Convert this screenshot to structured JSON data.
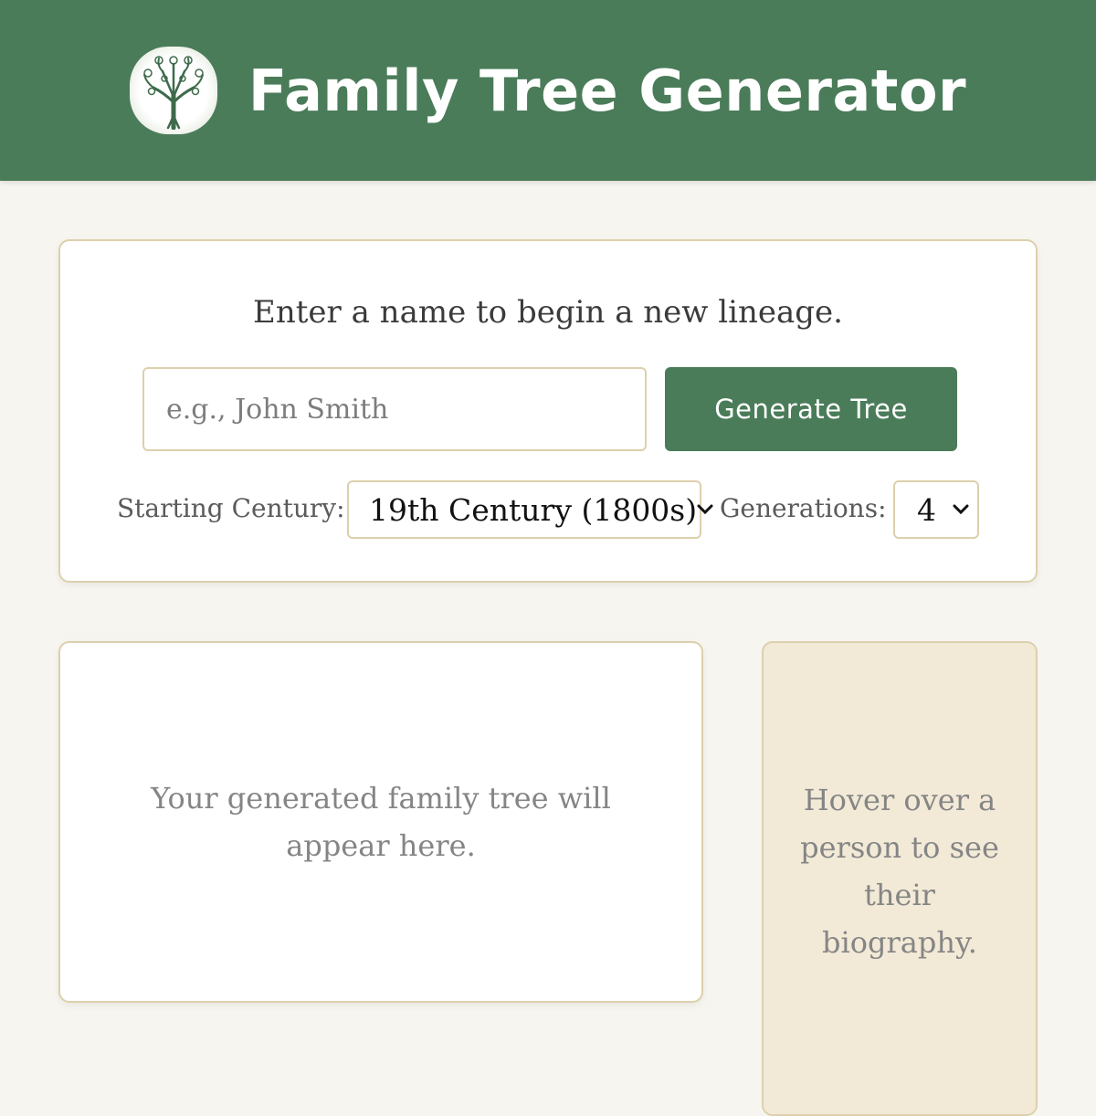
{
  "header": {
    "title": "Family Tree Generator",
    "logo_icon": "tree-logo-icon",
    "background_color": "#4a7c59"
  },
  "form": {
    "prompt": "Enter a name to begin a new lineage.",
    "name_input": {
      "value": "",
      "placeholder": "e.g., John Smith"
    },
    "generate_button_label": "Generate Tree",
    "century": {
      "label": "Starting Century:",
      "selected": "19th Century (1800s)"
    },
    "generations": {
      "label": "Generations:",
      "selected": "4"
    }
  },
  "tree_panel": {
    "message": "Your generated family tree will appear here."
  },
  "bio_panel": {
    "message": "Hover over a person to see their biography."
  },
  "colors": {
    "accent": "#4a7c59",
    "page_background": "#f7f5ef",
    "border": "#ddd0ad",
    "bio_background": "#f2ead7"
  }
}
